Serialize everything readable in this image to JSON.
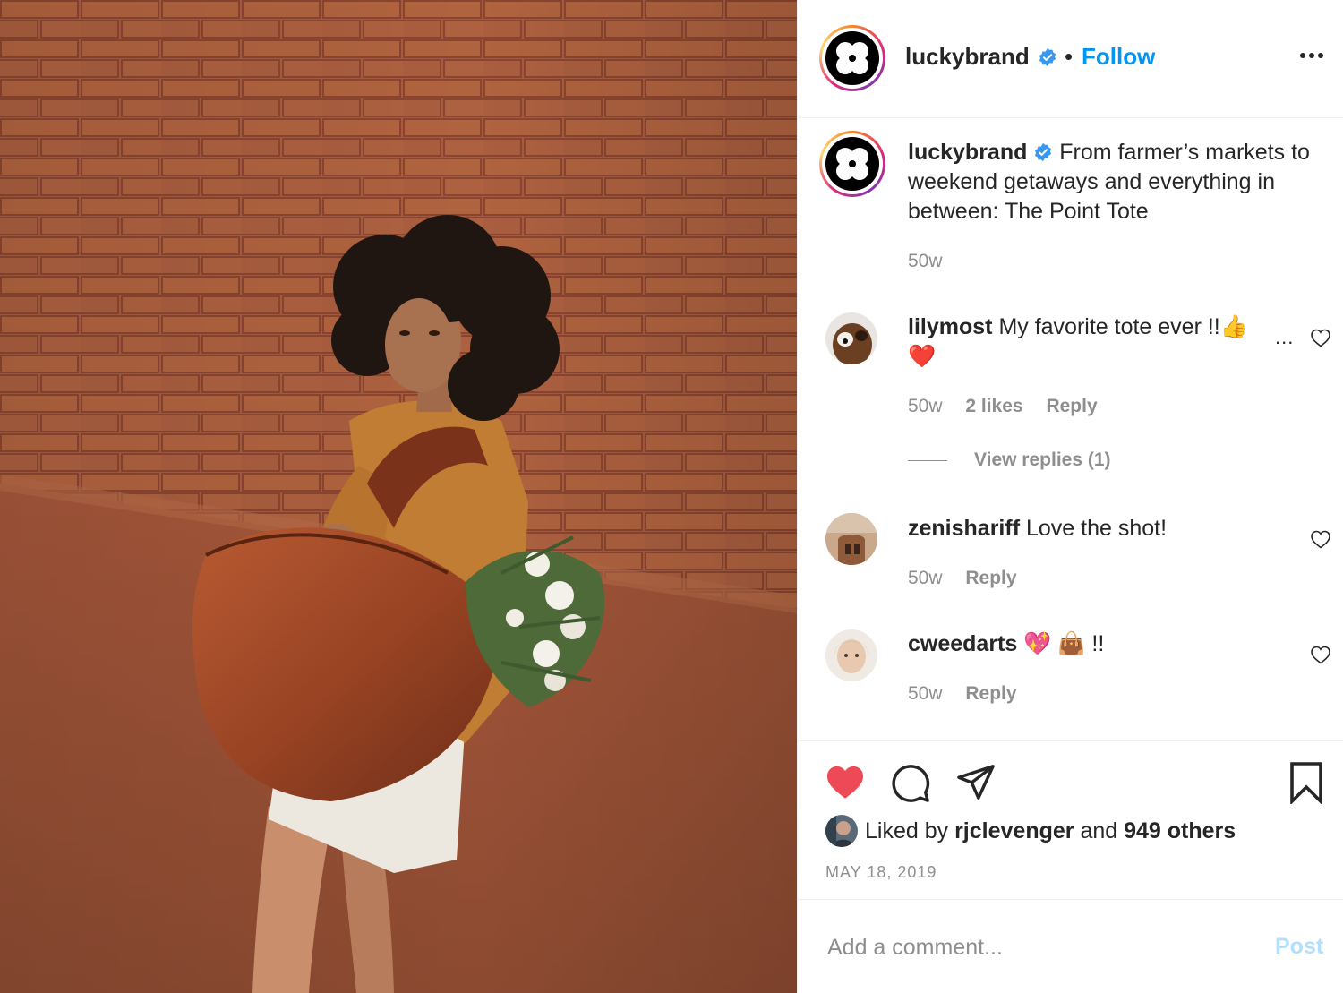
{
  "post": {
    "username": "luckybrand",
    "follow_label": "Follow",
    "separator": "•",
    "caption": "From farmer’s markets to weekend getaways and everything in between: The Point Tote",
    "caption_time": "50w"
  },
  "comments": [
    {
      "username": "lilymost",
      "text": "My favorite tote ever !!👍",
      "text_line2": "❤️",
      "time": "50w",
      "likes": "2 likes",
      "reply_label": "Reply",
      "more": "...",
      "view_replies": "View replies (1)"
    },
    {
      "username": "zenishariff",
      "text": "Love the shot!",
      "time": "50w",
      "reply_label": "Reply"
    },
    {
      "username": "cweedarts",
      "text": "💖 👜 !!",
      "time": "50w",
      "reply_label": "Reply"
    }
  ],
  "actions": {
    "liked_by_prefix": "Liked by",
    "liked_by_user": "rjclevenger",
    "liked_by_and": "and",
    "liked_by_others": "949 others",
    "date": "MAY 18, 2019",
    "heart_color": "#ed4956"
  },
  "add_comment": {
    "placeholder": "Add a comment...",
    "post_label": "Post"
  },
  "colors": {
    "link_blue": "#0095f6",
    "muted_gray": "#8e8e8e",
    "post_disabled": "#b2dffc",
    "brick": "#a35a3d"
  },
  "icons": {
    "verified": "verified-badge-icon",
    "more": "more-horizontal-icon",
    "like": "heart-filled-icon",
    "comment": "speech-bubble-icon",
    "share": "paper-plane-icon",
    "save": "bookmark-icon"
  }
}
